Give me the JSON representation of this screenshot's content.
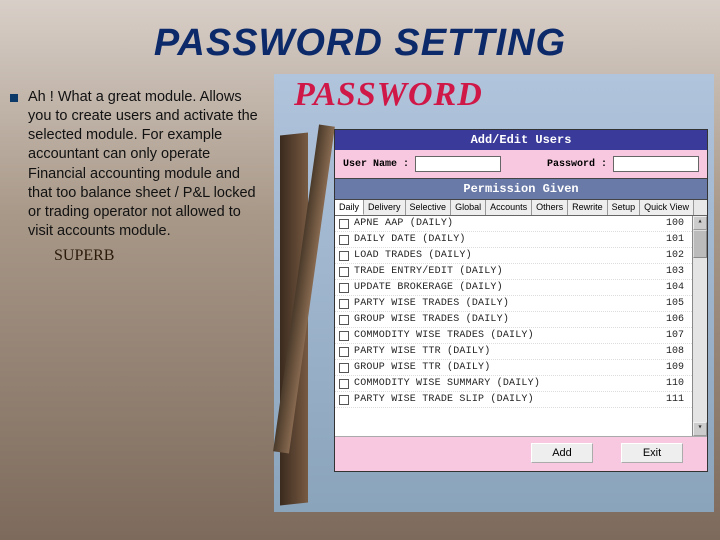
{
  "title": "PASSWORD SETTING",
  "bullet": "Ah ! What a great module. Allows you to create users and activate the selected module. For example accountant can only operate Financial accounting module and that too balance sheet / P&L locked or trading operator not allowed to visit accounts module.",
  "superb": "SUPERB",
  "screenshot_heading": "PASSWORD",
  "window": {
    "titlebar": "Add/Edit Users",
    "username_label": "User Name :",
    "password_label": "Password :",
    "username_value": "",
    "password_value": "",
    "perm_header": "Permission Given",
    "tabs": [
      "Daily",
      "Delivery",
      "Selective",
      "Global",
      "Accounts",
      "Others",
      "Rewrite",
      "Setup",
      "Quick View"
    ],
    "rows": [
      {
        "label": "APNE AAP (DAILY)",
        "code": "100"
      },
      {
        "label": "DAILY DATE (DAILY)",
        "code": "101"
      },
      {
        "label": "LOAD TRADES (DAILY)",
        "code": "102"
      },
      {
        "label": "TRADE ENTRY/EDIT (DAILY)",
        "code": "103"
      },
      {
        "label": "UPDATE BROKERAGE (DAILY)",
        "code": "104"
      },
      {
        "label": "PARTY WISE TRADES (DAILY)",
        "code": "105"
      },
      {
        "label": "GROUP WISE TRADES (DAILY)",
        "code": "106"
      },
      {
        "label": "COMMODITY WISE TRADES (DAILY)",
        "code": "107"
      },
      {
        "label": "PARTY WISE TTR (DAILY)",
        "code": "108"
      },
      {
        "label": "GROUP WISE TTR (DAILY)",
        "code": "109"
      },
      {
        "label": "COMMODITY WISE SUMMARY (DAILY)",
        "code": "110"
      },
      {
        "label": "PARTY WISE TRADE SLIP (DAILY)",
        "code": "111"
      }
    ],
    "buttons": {
      "add": "Add",
      "exit": "Exit"
    }
  }
}
